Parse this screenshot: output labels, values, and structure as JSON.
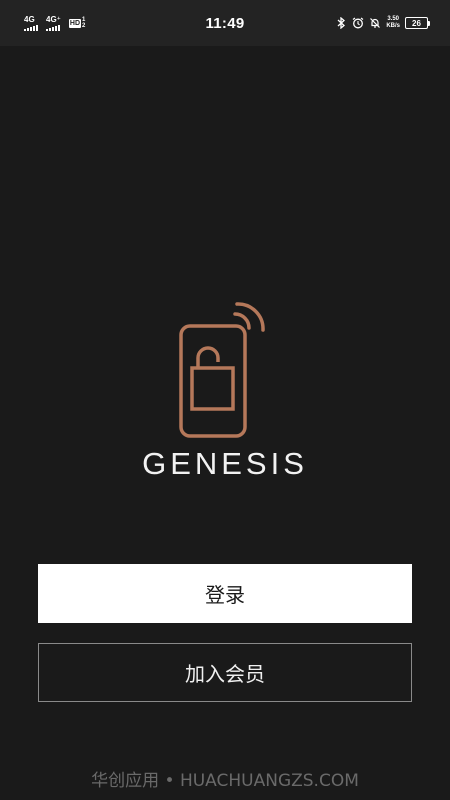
{
  "status_bar": {
    "sim1_label": "4G",
    "sim2_label": "4G⁺",
    "hd_label": "HD",
    "hd_sim_top": "1",
    "hd_sim_bottom": "2",
    "time": "11:49",
    "net_speed_value": "3.50",
    "net_speed_unit": "KB/s",
    "battery_level": "26"
  },
  "brand": {
    "name": "GENESIS",
    "accent_color": "#b5785a"
  },
  "actions": {
    "login_label": "登录",
    "join_label": "加入会员"
  },
  "watermark": {
    "text": "华创应用 • HUACHUANGZS.COM"
  }
}
